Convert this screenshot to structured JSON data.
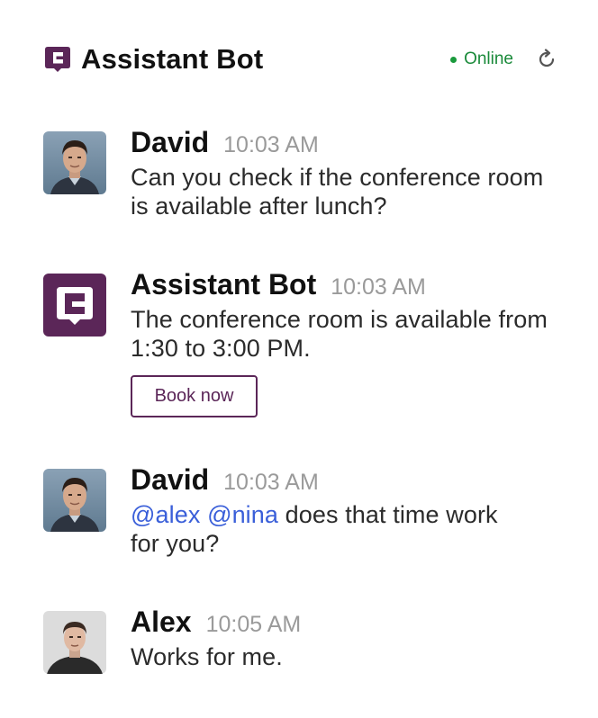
{
  "header": {
    "title": "Assistant Bot",
    "status": "Online",
    "status_color": "#1a8a3a",
    "logo_icon": "chat-bubble-logo-icon",
    "refresh_icon": "refresh-icon"
  },
  "brand_color": "#5b2658",
  "messages": [
    {
      "author": "David",
      "time": "10:03 AM",
      "text": "Can you check if the conference room is available after lunch?"
    },
    {
      "author": "Assistant Bot",
      "time": "10:03 AM",
      "text": "The conference room is available from 1:30 to 3:00 PM.",
      "action_label": "Book now"
    },
    {
      "author": "David",
      "time": "10:03 AM",
      "mentions": [
        "@alex",
        "@nina"
      ],
      "text": "does that time work for you?"
    },
    {
      "author": "Alex",
      "time": "10:05 AM",
      "text": "Works for me."
    }
  ]
}
